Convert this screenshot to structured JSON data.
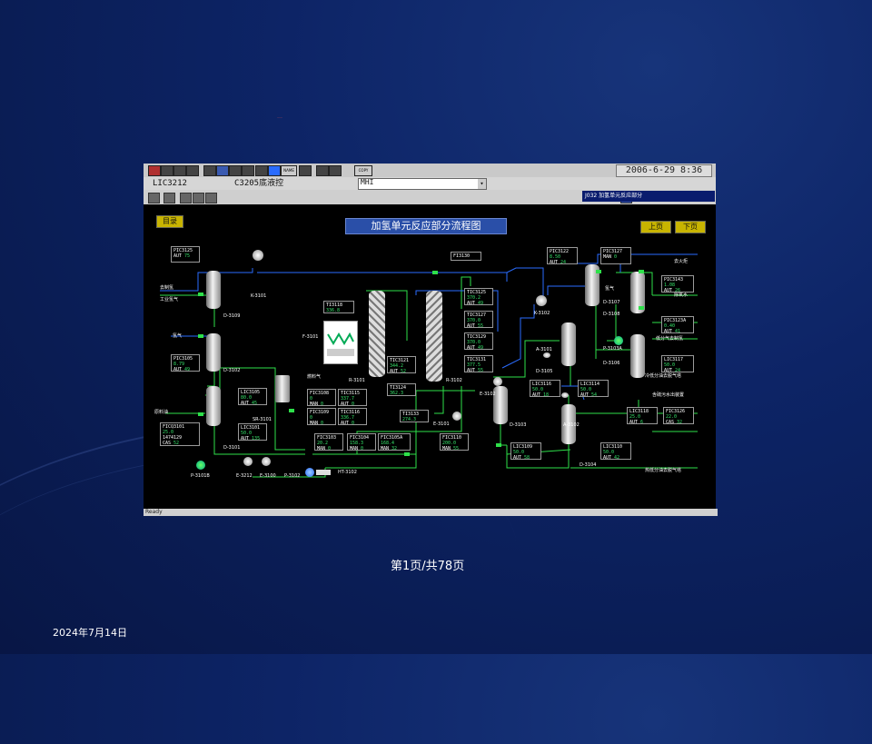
{
  "header_mark": "——",
  "toolbar": {
    "datetime": "2006-6-29 8:36",
    "copy_label": "COPY",
    "name_label": "NAME"
  },
  "tag_bar": {
    "tag": "LIC3212",
    "description": "C3205底液控",
    "mode": "MHI"
  },
  "panel_strip": "J032 加氢单元反应部分",
  "status_text": "Ready",
  "nav": {
    "index": "目录",
    "prev": "上页",
    "next": "下页"
  },
  "diagram_title": "加氢单元反应部分流程图",
  "equipment": {
    "D3109": "D-3109",
    "K3101": "K-3101",
    "D3102": "D-3102",
    "D3101": "D-3101",
    "F3101": "F-3101",
    "R3101": "R-3101",
    "R3102": "R-3102",
    "E3101": "E-3101",
    "SR3101": "SR-3101",
    "P3101B": "P-3101B",
    "E3212": "E-3212",
    "E3100": "E-3100",
    "P3102": "P-3102",
    "HT3102": "HT-3102",
    "D3103": "D-3103",
    "A3101": "A-3101",
    "D3105": "D-3105",
    "A3102": "A-3102",
    "D3104": "D-3104",
    "D3107": "D-3107",
    "D3108": "D-3108",
    "P3103A": "P-3103A",
    "D3106": "D-3106",
    "K3102": "K-3102",
    "E3102": "E-3102"
  },
  "stream_labels": {
    "to_hydrogen": "去制氢",
    "industrial_h2": "工业氢气",
    "hydrogen1": "氢气",
    "feed": "原料油",
    "fuel_gas": "燃料气",
    "to_flare": "去火炬",
    "hydrogen2": "氢气",
    "deaerated": "除氧水",
    "low_sep_gas": "低分气去制氢",
    "cold_low_sep": "冷低分油去脱气塔",
    "sour_water": "含硫污水出装置",
    "hot_low_sep": "热低分油去脱气塔"
  },
  "controllers": {
    "PIC3125": {
      "tag": "PIC3125",
      "mode": "AUT",
      "value": "75"
    },
    "PIC3105": {
      "tag": "PIC3105",
      "pv": "8.79",
      "mode": "AUT",
      "value": "49"
    },
    "FICQ3101": {
      "tag": "FICQ3101",
      "pv": "25.0",
      "total": "1474129",
      "mode": "CAS",
      "value": "52"
    },
    "LIC3105": {
      "tag": "LIC3105",
      "pv": "80.0",
      "mode": "AUT",
      "value": "45"
    },
    "LIC3101": {
      "tag": "LIC3101",
      "pv": "50.0",
      "mode": "AUT",
      "value": "135"
    },
    "TI3118": {
      "tag": "TI3118",
      "pv": "336.8"
    },
    "FI3130": {
      "tag": "FI3130"
    },
    "FIC3108": {
      "tag": "FIC3108",
      "pv": "0",
      "mode": "MAN",
      "value": "0"
    },
    "TIC3115": {
      "tag": "TIC3115",
      "pv": "337.7",
      "mode": "AUT",
      "value": "0"
    },
    "FIC3109": {
      "tag": "FIC3109",
      "pv": "0",
      "mode": "MAN",
      "value": "0"
    },
    "TIC3116": {
      "tag": "TIC3116",
      "pv": "336.7",
      "mode": "AUT",
      "value": "0"
    },
    "TIC3121": {
      "tag": "TIC3121",
      "pv": "344.2",
      "mode": "AUT",
      "value": "52"
    },
    "TI3124": {
      "tag": "TI3124",
      "pv": "362.3"
    },
    "TIC3125": {
      "tag": "TIC3125",
      "pv": "370.2",
      "mode": "AUT",
      "value": "49"
    },
    "TIC3127": {
      "tag": "TIC3127",
      "pv": "370.0",
      "mode": "AUT",
      "value": "55"
    },
    "TIC3129": {
      "tag": "TIC3129",
      "pv": "370.0",
      "mode": "AUT",
      "value": "49"
    },
    "TIC3131": {
      "tag": "TIC3131",
      "pv": "377.5",
      "mode": "AUT",
      "value": "55"
    },
    "TI3133": {
      "tag": "TI3133",
      "pv": "274.3"
    },
    "FIC3103": {
      "tag": "FIC3103",
      "pv": "20.2",
      "mode": "MAN",
      "value": "0"
    },
    "FIC3104": {
      "tag": "FIC3104",
      "pv": "158.3",
      "mode": "MAN",
      "value": "0"
    },
    "FIC3105A": {
      "tag": "FIC3105A",
      "pv": "168.4",
      "mode": "MAN",
      "value": "32"
    },
    "FIC3110": {
      "tag": "FIC3110",
      "pv": "200.0",
      "mode": "MAN",
      "value": "55"
    },
    "PIC3122": {
      "tag": "PIC3122",
      "pv": "8.50",
      "mode": "AUT",
      "value": "24"
    },
    "PIC3127": {
      "tag": "PIC3127",
      "mode": "MAN",
      "value": "0"
    },
    "PIC3143": {
      "tag": "PIC3143",
      "pv": "1.08",
      "mode": "AUT",
      "value": "26"
    },
    "PIC3123A": {
      "tag": "PIC3123A",
      "pv": "0.40",
      "mode": "AUT",
      "value": "41"
    },
    "LIC3117": {
      "tag": "LIC3117",
      "pv": "50.0",
      "mode": "AUT",
      "value": "24"
    },
    "LIC3116": {
      "tag": "LIC3116",
      "pv": "50.0",
      "mode": "AUT",
      "value": "18"
    },
    "LIC3114": {
      "tag": "LIC3114",
      "pv": "50.0",
      "mode": "AUT",
      "value": "54"
    },
    "LIC3118": {
      "tag": "LIC3118",
      "pv": "25.0",
      "mode": "AUT",
      "value": "6"
    },
    "FIC3126": {
      "tag": "FIC3126",
      "pv": "22.0",
      "mode": "CAS",
      "value": "32"
    },
    "LIC3109": {
      "tag": "LIC3109",
      "pv": "50.0",
      "mode": "AUT",
      "value": "58"
    },
    "LIC3110": {
      "tag": "LIC3110",
      "pv": "50.0",
      "mode": "AUT",
      "value": "42"
    }
  },
  "footer": {
    "page": "第1页/共78页",
    "date": "2024年7月14日"
  },
  "colors": {
    "pipe_green": "#2ee04a",
    "pipe_blue": "#2a6cff",
    "value_green": "#36e36a",
    "title_bg": "#2a4fa8",
    "nav_bg": "#c8b400"
  }
}
